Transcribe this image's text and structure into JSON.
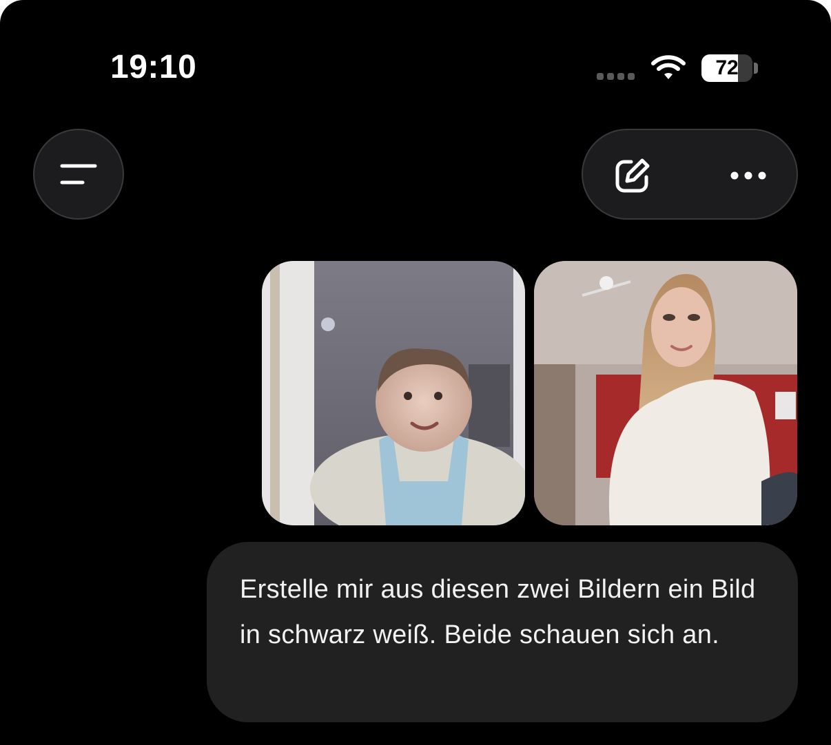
{
  "status_bar": {
    "time": "19:10",
    "battery_level": "72",
    "battery_fraction": 0.72,
    "wifi_icon": "wifi-icon",
    "signal_icon": "cellular-signal-icon"
  },
  "toolbar": {
    "menu_icon": "sidebar-menu-icon",
    "edit_icon": "new-chat-edit-icon",
    "more_icon": "more-horizontal-icon"
  },
  "conversation": {
    "user_message": {
      "attachments": [
        {
          "kind": "photo",
          "subject": "baby-photo"
        },
        {
          "kind": "photo",
          "subject": "selfie-photo"
        }
      ],
      "text": "Erstelle mir aus diesen zwei Bildern ein Bild in schwarz weiß. Beide schauen sich an."
    }
  },
  "colors": {
    "background": "#000000",
    "bubble": "#212121",
    "control_bg": "#1c1c1e",
    "control_border": "#3a3a3c",
    "text": "#f2f2f2"
  }
}
